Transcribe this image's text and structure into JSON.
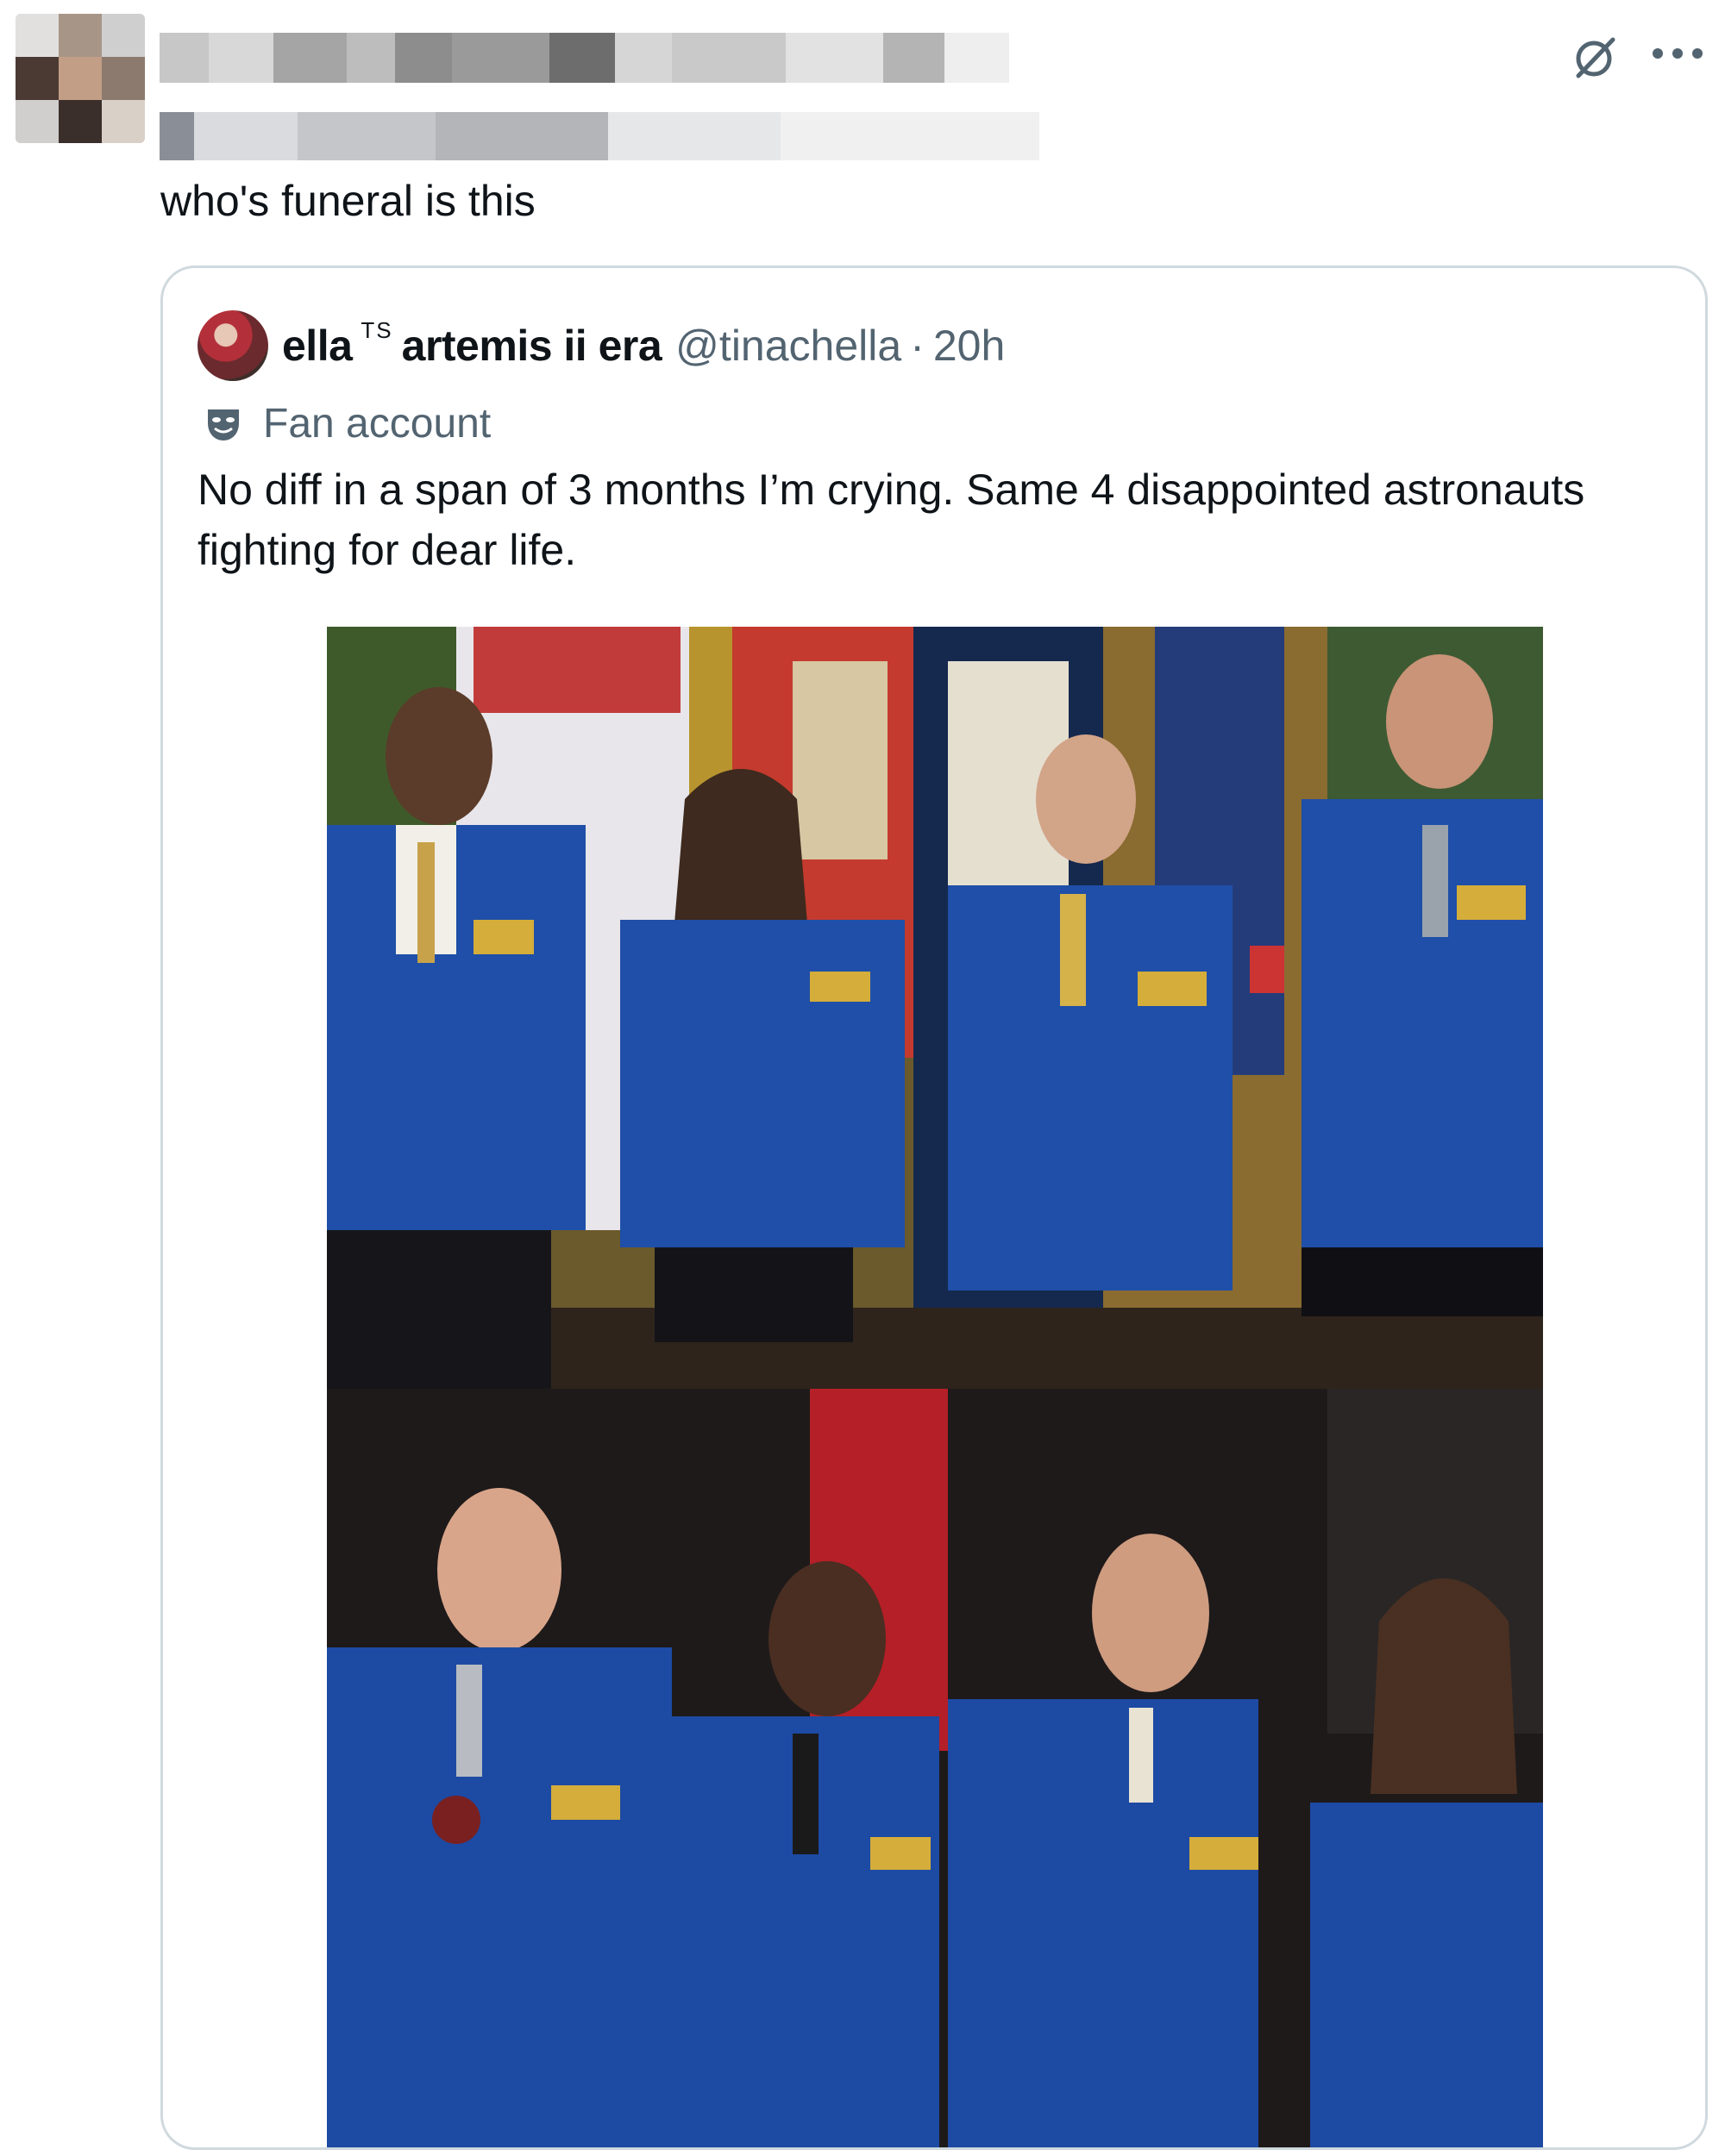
{
  "tweet": {
    "text": "who's funeral is this"
  },
  "quoted_tweet": {
    "display_name": "ella",
    "name_badge": "TS",
    "name_suffix": "artemis ii era",
    "handle": "@tinachella",
    "separator": "·",
    "time": "20h",
    "label": "Fan account",
    "body": "No diff in a span of 3 months I’m crying. Same 4 disappointed astronauts fighting for dear life."
  },
  "icons": {
    "edit": "slashed-circle-icon",
    "more": "more-dots-icon",
    "label": "theater-mask-icon"
  },
  "colors": {
    "text_primary": "#0f1419",
    "text_secondary": "#536471",
    "card_border": "#cfd9de",
    "jacket_blue": "#1f4fa8"
  }
}
